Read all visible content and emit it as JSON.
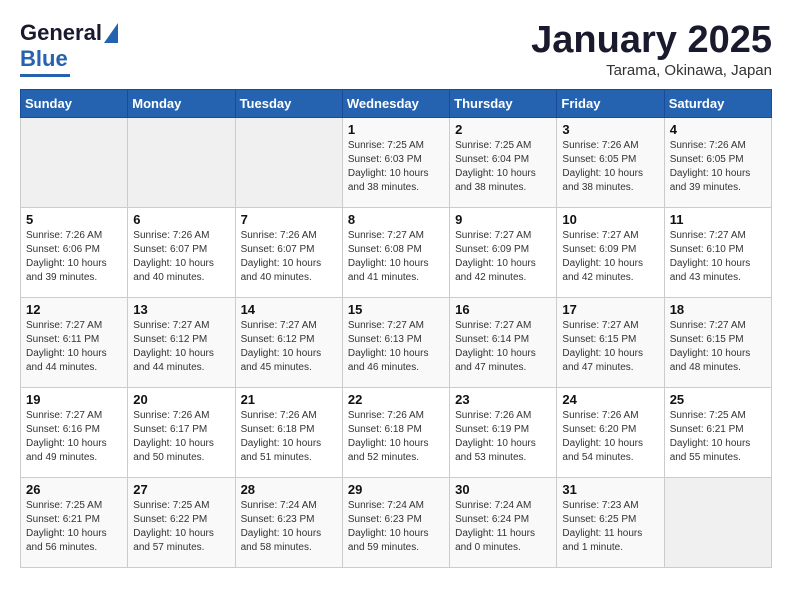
{
  "header": {
    "logo_general": "General",
    "logo_blue": "Blue",
    "title": "January 2025",
    "subtitle": "Tarama, Okinawa, Japan"
  },
  "weekdays": [
    "Sunday",
    "Monday",
    "Tuesday",
    "Wednesday",
    "Thursday",
    "Friday",
    "Saturday"
  ],
  "weeks": [
    [
      {
        "day": "",
        "info": ""
      },
      {
        "day": "",
        "info": ""
      },
      {
        "day": "",
        "info": ""
      },
      {
        "day": "1",
        "info": "Sunrise: 7:25 AM\nSunset: 6:03 PM\nDaylight: 10 hours\nand 38 minutes."
      },
      {
        "day": "2",
        "info": "Sunrise: 7:25 AM\nSunset: 6:04 PM\nDaylight: 10 hours\nand 38 minutes."
      },
      {
        "day": "3",
        "info": "Sunrise: 7:26 AM\nSunset: 6:05 PM\nDaylight: 10 hours\nand 38 minutes."
      },
      {
        "day": "4",
        "info": "Sunrise: 7:26 AM\nSunset: 6:05 PM\nDaylight: 10 hours\nand 39 minutes."
      }
    ],
    [
      {
        "day": "5",
        "info": "Sunrise: 7:26 AM\nSunset: 6:06 PM\nDaylight: 10 hours\nand 39 minutes."
      },
      {
        "day": "6",
        "info": "Sunrise: 7:26 AM\nSunset: 6:07 PM\nDaylight: 10 hours\nand 40 minutes."
      },
      {
        "day": "7",
        "info": "Sunrise: 7:26 AM\nSunset: 6:07 PM\nDaylight: 10 hours\nand 40 minutes."
      },
      {
        "day": "8",
        "info": "Sunrise: 7:27 AM\nSunset: 6:08 PM\nDaylight: 10 hours\nand 41 minutes."
      },
      {
        "day": "9",
        "info": "Sunrise: 7:27 AM\nSunset: 6:09 PM\nDaylight: 10 hours\nand 42 minutes."
      },
      {
        "day": "10",
        "info": "Sunrise: 7:27 AM\nSunset: 6:09 PM\nDaylight: 10 hours\nand 42 minutes."
      },
      {
        "day": "11",
        "info": "Sunrise: 7:27 AM\nSunset: 6:10 PM\nDaylight: 10 hours\nand 43 minutes."
      }
    ],
    [
      {
        "day": "12",
        "info": "Sunrise: 7:27 AM\nSunset: 6:11 PM\nDaylight: 10 hours\nand 44 minutes."
      },
      {
        "day": "13",
        "info": "Sunrise: 7:27 AM\nSunset: 6:12 PM\nDaylight: 10 hours\nand 44 minutes."
      },
      {
        "day": "14",
        "info": "Sunrise: 7:27 AM\nSunset: 6:12 PM\nDaylight: 10 hours\nand 45 minutes."
      },
      {
        "day": "15",
        "info": "Sunrise: 7:27 AM\nSunset: 6:13 PM\nDaylight: 10 hours\nand 46 minutes."
      },
      {
        "day": "16",
        "info": "Sunrise: 7:27 AM\nSunset: 6:14 PM\nDaylight: 10 hours\nand 47 minutes."
      },
      {
        "day": "17",
        "info": "Sunrise: 7:27 AM\nSunset: 6:15 PM\nDaylight: 10 hours\nand 47 minutes."
      },
      {
        "day": "18",
        "info": "Sunrise: 7:27 AM\nSunset: 6:15 PM\nDaylight: 10 hours\nand 48 minutes."
      }
    ],
    [
      {
        "day": "19",
        "info": "Sunrise: 7:27 AM\nSunset: 6:16 PM\nDaylight: 10 hours\nand 49 minutes."
      },
      {
        "day": "20",
        "info": "Sunrise: 7:26 AM\nSunset: 6:17 PM\nDaylight: 10 hours\nand 50 minutes."
      },
      {
        "day": "21",
        "info": "Sunrise: 7:26 AM\nSunset: 6:18 PM\nDaylight: 10 hours\nand 51 minutes."
      },
      {
        "day": "22",
        "info": "Sunrise: 7:26 AM\nSunset: 6:18 PM\nDaylight: 10 hours\nand 52 minutes."
      },
      {
        "day": "23",
        "info": "Sunrise: 7:26 AM\nSunset: 6:19 PM\nDaylight: 10 hours\nand 53 minutes."
      },
      {
        "day": "24",
        "info": "Sunrise: 7:26 AM\nSunset: 6:20 PM\nDaylight: 10 hours\nand 54 minutes."
      },
      {
        "day": "25",
        "info": "Sunrise: 7:25 AM\nSunset: 6:21 PM\nDaylight: 10 hours\nand 55 minutes."
      }
    ],
    [
      {
        "day": "26",
        "info": "Sunrise: 7:25 AM\nSunset: 6:21 PM\nDaylight: 10 hours\nand 56 minutes."
      },
      {
        "day": "27",
        "info": "Sunrise: 7:25 AM\nSunset: 6:22 PM\nDaylight: 10 hours\nand 57 minutes."
      },
      {
        "day": "28",
        "info": "Sunrise: 7:24 AM\nSunset: 6:23 PM\nDaylight: 10 hours\nand 58 minutes."
      },
      {
        "day": "29",
        "info": "Sunrise: 7:24 AM\nSunset: 6:23 PM\nDaylight: 10 hours\nand 59 minutes."
      },
      {
        "day": "30",
        "info": "Sunrise: 7:24 AM\nSunset: 6:24 PM\nDaylight: 11 hours\nand 0 minutes."
      },
      {
        "day": "31",
        "info": "Sunrise: 7:23 AM\nSunset: 6:25 PM\nDaylight: 11 hours\nand 1 minute."
      },
      {
        "day": "",
        "info": ""
      }
    ]
  ]
}
